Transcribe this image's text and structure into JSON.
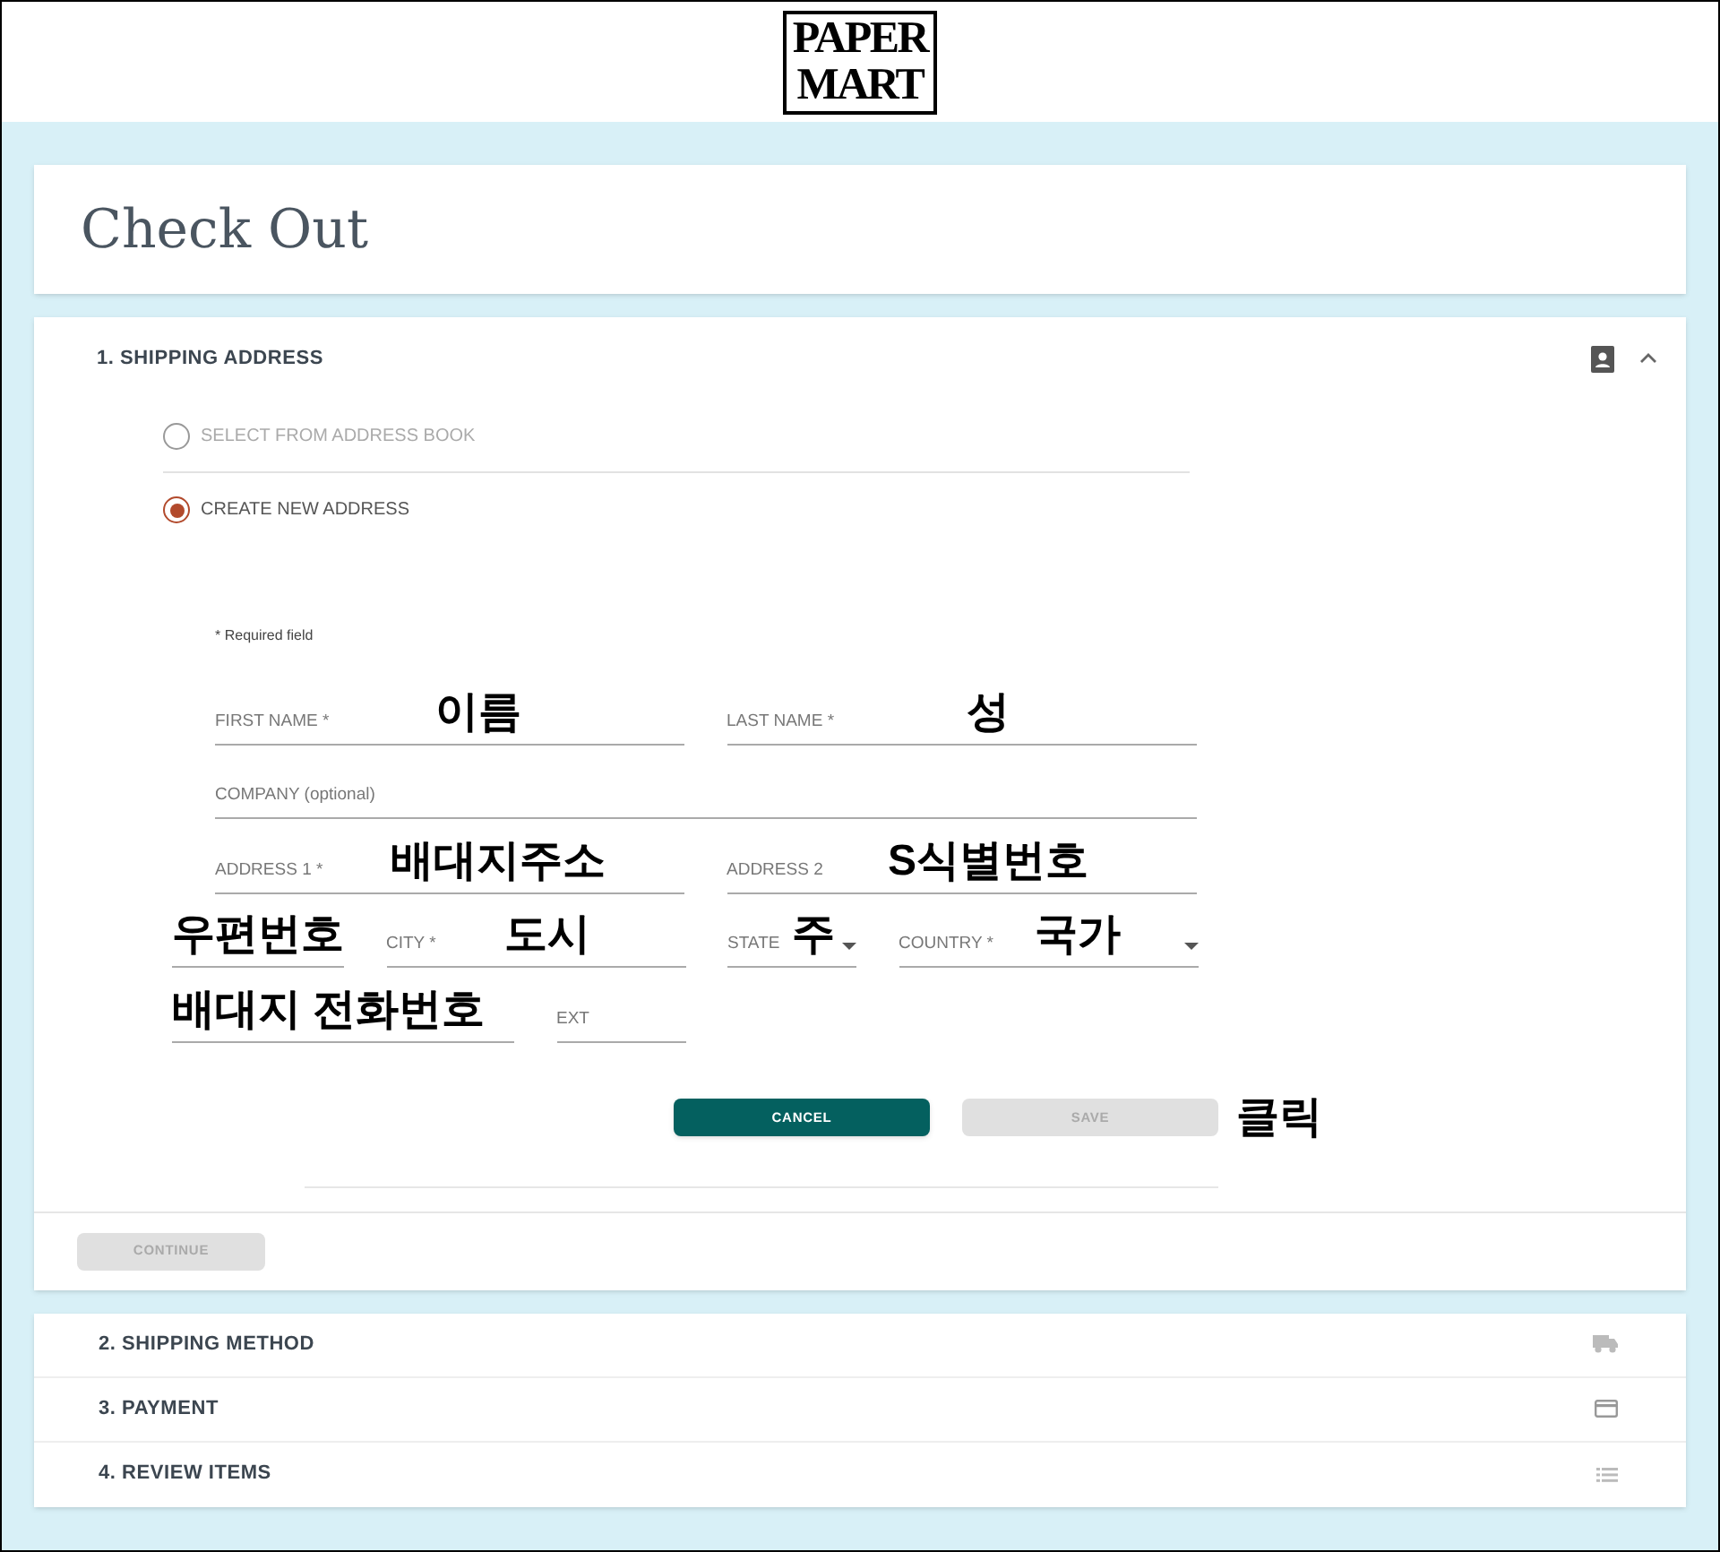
{
  "header": {
    "logo_lines": [
      "PAPER",
      "MART"
    ]
  },
  "page_title": "Check Out",
  "shipping_address": {
    "title": "1. SHIPPING ADDRESS",
    "expanded": true,
    "options": [
      {
        "label": "SELECT FROM ADDRESS BOOK",
        "selected": false
      },
      {
        "label": "CREATE NEW ADDRESS",
        "selected": true
      }
    ],
    "required_note": "* Required field",
    "rows": [
      [
        {
          "kind": "text",
          "label": "FIRST NAME *",
          "annotation": "이름"
        },
        {
          "kind": "text",
          "label": "LAST NAME *",
          "annotation": "성"
        }
      ],
      [
        {
          "kind": "text",
          "label": "COMPANY (optional)"
        }
      ],
      [
        {
          "kind": "text",
          "label": "ADDRESS 1 *",
          "annotation": "배대지주소"
        },
        {
          "kind": "text",
          "label": "ADDRESS 2",
          "annotation": "S식별번호"
        }
      ],
      [
        {
          "kind": "text",
          "annotation": "우편번호"
        },
        {
          "kind": "text",
          "label": "CITY *",
          "annotation": "도시"
        },
        {
          "kind": "select",
          "label": "STATE",
          "annotation": "주"
        },
        {
          "kind": "select",
          "label": "COUNTRY *",
          "annotation": "국가"
        }
      ],
      [
        {
          "kind": "text",
          "annotation": "배대지 전화번호"
        },
        {
          "kind": "text",
          "label": "EXT"
        }
      ]
    ],
    "buttons": [
      {
        "label": "CANCEL",
        "disabled": false
      },
      {
        "label": "SAVE",
        "disabled": true
      }
    ],
    "button_annotation": "클릭",
    "continue_button": {
      "label": "CONTINUE",
      "disabled": true
    }
  },
  "other_steps": [
    {
      "title": "2. SHIPPING METHOD"
    },
    {
      "title": "3. PAYMENT"
    },
    {
      "title": "4. REVIEW ITEMS"
    }
  ]
}
